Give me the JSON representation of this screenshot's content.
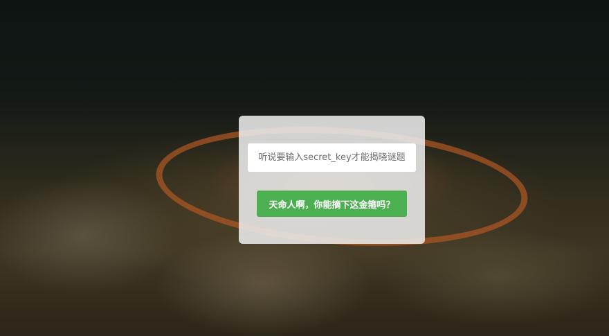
{
  "form": {
    "input_placeholder": "听说要输入secret_key才能揭晓谜题",
    "input_value": "",
    "submit_label": "天命人啊，你能摘下这金箍吗？"
  },
  "colors": {
    "button": "#4caf50"
  }
}
